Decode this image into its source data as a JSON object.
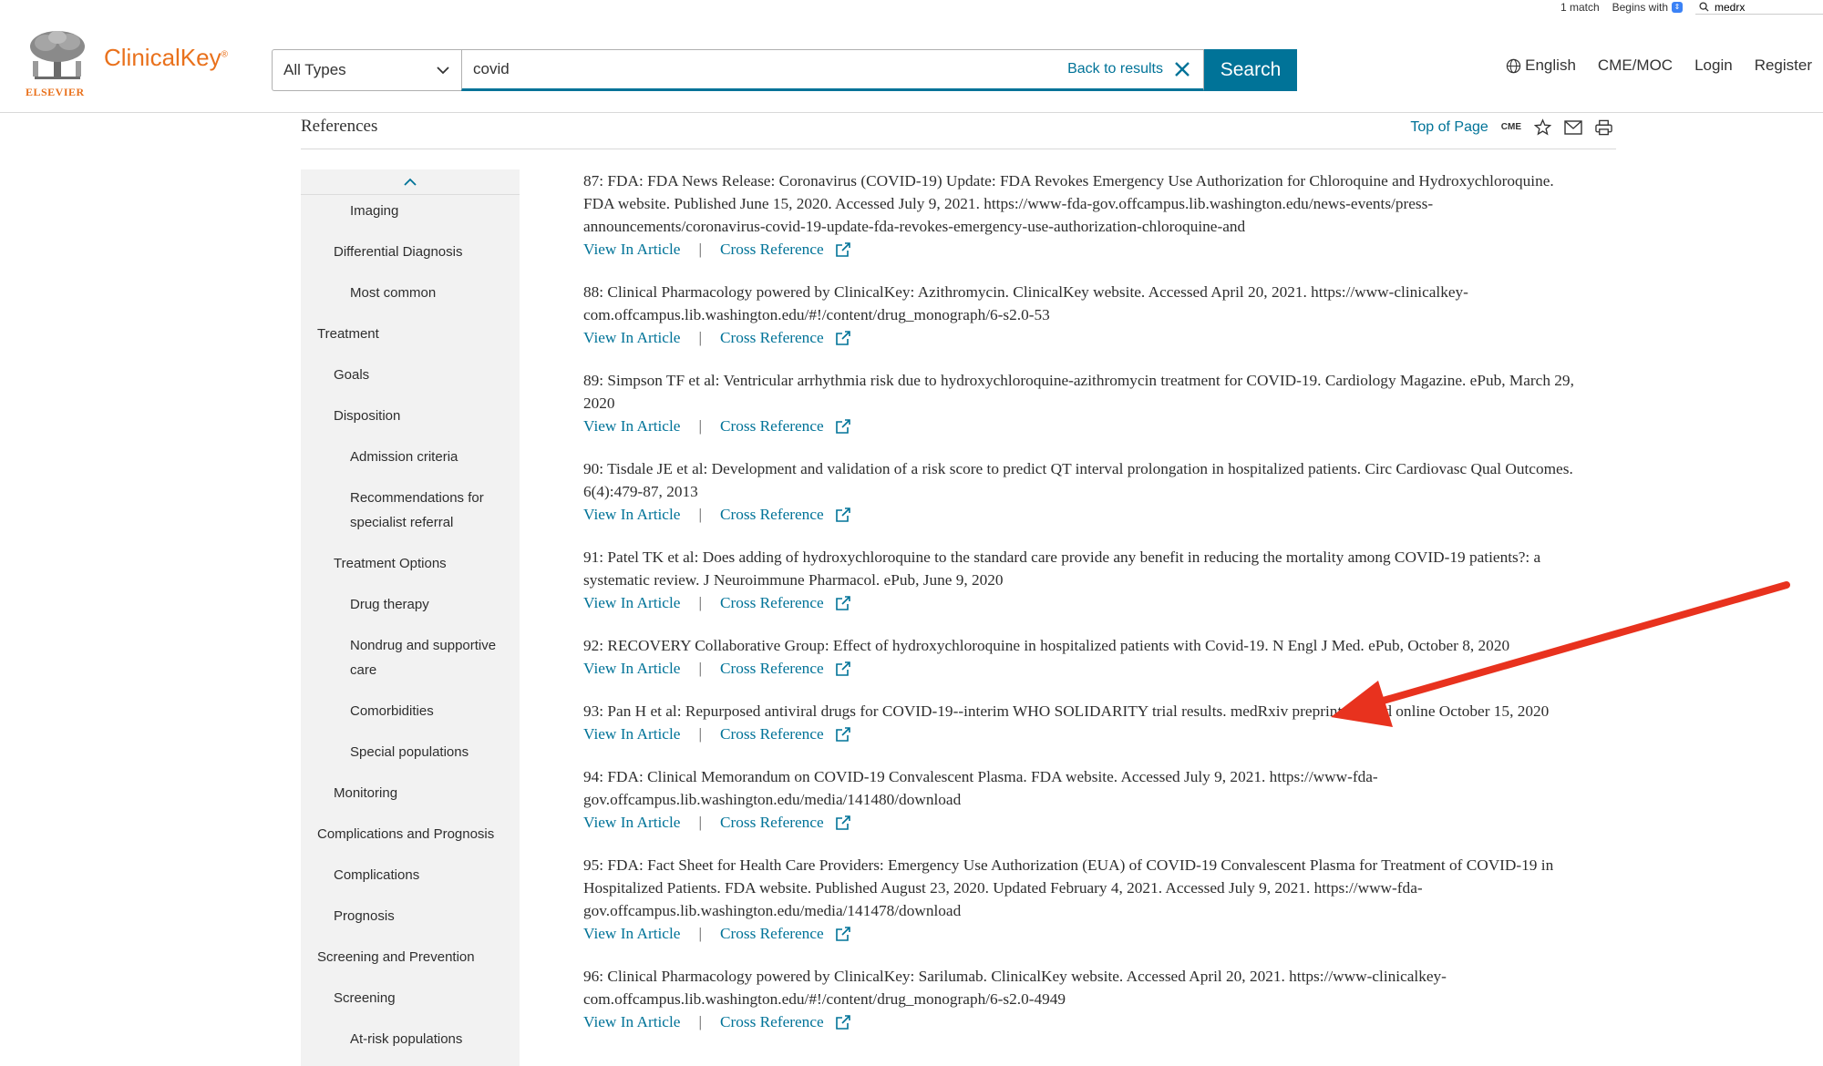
{
  "find_bar": {
    "match_count": "1 match",
    "mode": "Begins with",
    "query": "medrx"
  },
  "header": {
    "brand": "ClinicalKey",
    "publisher": "ELSEVIER",
    "type_select": "All Types",
    "query": "covid",
    "back_to_results": "Back to results",
    "search_button": "Search",
    "nav": {
      "language": "English",
      "cme": "CME/MOC",
      "login": "Login",
      "register": "Register"
    }
  },
  "section": {
    "title": "References",
    "top_of_page": "Top of Page",
    "cme_badge": "CME"
  },
  "sidebar": {
    "items": [
      {
        "label": "Imaging",
        "level": 3
      },
      {
        "label": "Differential Diagnosis",
        "level": 2
      },
      {
        "label": "Most common",
        "level": 3
      },
      {
        "label": "Treatment",
        "level": 1
      },
      {
        "label": "Goals",
        "level": 2
      },
      {
        "label": "Disposition",
        "level": 2
      },
      {
        "label": "Admission criteria",
        "level": 3
      },
      {
        "label": "Recommendations for specialist referral",
        "level": 3
      },
      {
        "label": "Treatment Options",
        "level": 2
      },
      {
        "label": "Drug therapy",
        "level": 3
      },
      {
        "label": "Nondrug and supportive care",
        "level": 3
      },
      {
        "label": "Comorbidities",
        "level": 3
      },
      {
        "label": "Special populations",
        "level": 3
      },
      {
        "label": "Monitoring",
        "level": 2
      },
      {
        "label": "Complications and Prognosis",
        "level": 1
      },
      {
        "label": "Complications",
        "level": 2
      },
      {
        "label": "Prognosis",
        "level": 2
      },
      {
        "label": "Screening and Prevention",
        "level": 1
      },
      {
        "label": "Screening",
        "level": 2
      },
      {
        "label": "At-risk populations",
        "level": 3
      }
    ]
  },
  "references": {
    "view_label": "View In Article",
    "cross_label": "Cross Reference",
    "separator": "|",
    "items": [
      {
        "num": "87:",
        "text": "FDA: FDA News Release: Coronavirus (COVID-19) Update: FDA Revokes Emergency Use Authorization for Chloroquine and Hydroxychloroquine. FDA website. Published June 15, 2020. Accessed July 9, 2021. https://www-fda-gov.offcampus.lib.washington.edu/news-events/press-announcements/coronavirus-covid-19-update-fda-revokes-emergency-use-authorization-chloroquine-and"
      },
      {
        "num": "88:",
        "text": "Clinical Pharmacology powered by ClinicalKey: Azithromycin. ClinicalKey website. Accessed April 20, 2021. https://www-clinicalkey-com.offcampus.lib.washington.edu/#!/content/drug_monograph/6-s2.0-53"
      },
      {
        "num": "89:",
        "text": "Simpson TF et al: Ventricular arrhythmia risk due to hydroxychloroquine-azithromycin treatment for COVID-19. Cardiology Magazine. ePub, March 29, 2020"
      },
      {
        "num": "90:",
        "text": "Tisdale JE et al: Development and validation of a risk score to predict QT interval prolongation in hospitalized patients. Circ Cardiovasc Qual Outcomes. 6(4):479-87, 2013"
      },
      {
        "num": "91:",
        "text": "Patel TK et al: Does adding of hydroxychloroquine to the standard care provide any benefit in reducing the mortality among COVID-19 patients?: a systematic review. J Neuroimmune Pharmacol. ePub, June 9, 2020"
      },
      {
        "num": "92:",
        "text": "RECOVERY Collaborative Group: Effect of hydroxychloroquine in hospitalized patients with Covid-19. N Engl J Med. ePub, October 8, 2020"
      },
      {
        "num": "93:",
        "text": "Pan H et al: Repurposed antiviral drugs for COVID-19--interim WHO SOLIDARITY trial results. medRxiv preprint. Posted online October 15, 2020"
      },
      {
        "num": "94:",
        "text": "FDA: Clinical Memorandum on COVID-19 Convalescent Plasma. FDA website. Accessed July 9, 2021. https://www-fda-gov.offcampus.lib.washington.edu/media/141480/download"
      },
      {
        "num": "95:",
        "text": "FDA: Fact Sheet for Health Care Providers: Emergency Use Authorization (EUA) of COVID-19 Convalescent Plasma for Treatment of COVID-19 in Hospitalized Patients. FDA website. Published August 23, 2020. Updated February 4, 2021. Accessed July 9, 2021. https://www-fda-gov.offcampus.lib.washington.edu/media/141478/download"
      },
      {
        "num": "96:",
        "text": "Clinical Pharmacology powered by ClinicalKey: Sarilumab. ClinicalKey website. Accessed April 20, 2021. https://www-clinicalkey-com.offcampus.lib.washington.edu/#!/content/drug_monograph/6-s2.0-4949"
      }
    ]
  },
  "annotation": {
    "arrow_color": "#e8321e"
  },
  "colors": {
    "brand_orange": "#e9711c",
    "link_teal": "#007398"
  }
}
